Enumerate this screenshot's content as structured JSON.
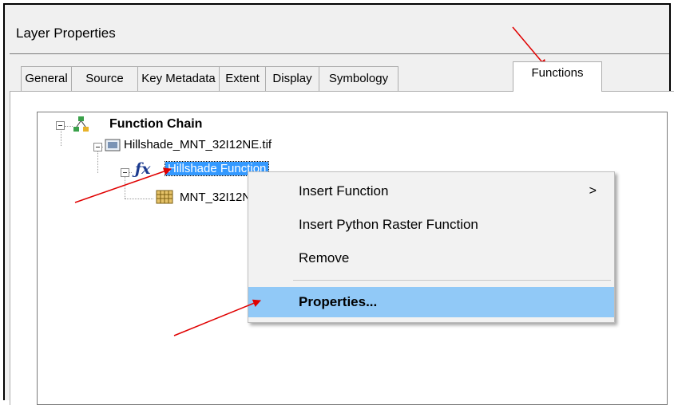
{
  "window": {
    "title": "Layer Properties"
  },
  "tabs": [
    {
      "label": "General"
    },
    {
      "label": "Source"
    },
    {
      "label": "Key Metadata"
    },
    {
      "label": "Extent"
    },
    {
      "label": "Display"
    },
    {
      "label": "Symbology"
    },
    {
      "label": "Functions",
      "active": true
    }
  ],
  "tree": {
    "root": {
      "label": "Function Chain",
      "icon": "function-chain-icon"
    },
    "raster": {
      "label": "Hillshade_MNT_32I12NE.tif",
      "icon": "raster-image-icon"
    },
    "function": {
      "label": "Hillshade Function",
      "icon": "function-icon"
    },
    "input": {
      "label": "MNT_32I12NE",
      "icon": "raster-grid-icon"
    }
  },
  "context_menu": {
    "items": [
      {
        "label": "Insert Function",
        "submenu_indicator": ">"
      },
      {
        "label": "Insert Python Raster Function"
      },
      {
        "label": "Remove"
      },
      {
        "label": "Properties...",
        "highlighted": true
      }
    ]
  },
  "colors": {
    "selection": "#3399ff",
    "menu_highlight": "#91c9f7",
    "annotation_arrow": "#e00000"
  }
}
